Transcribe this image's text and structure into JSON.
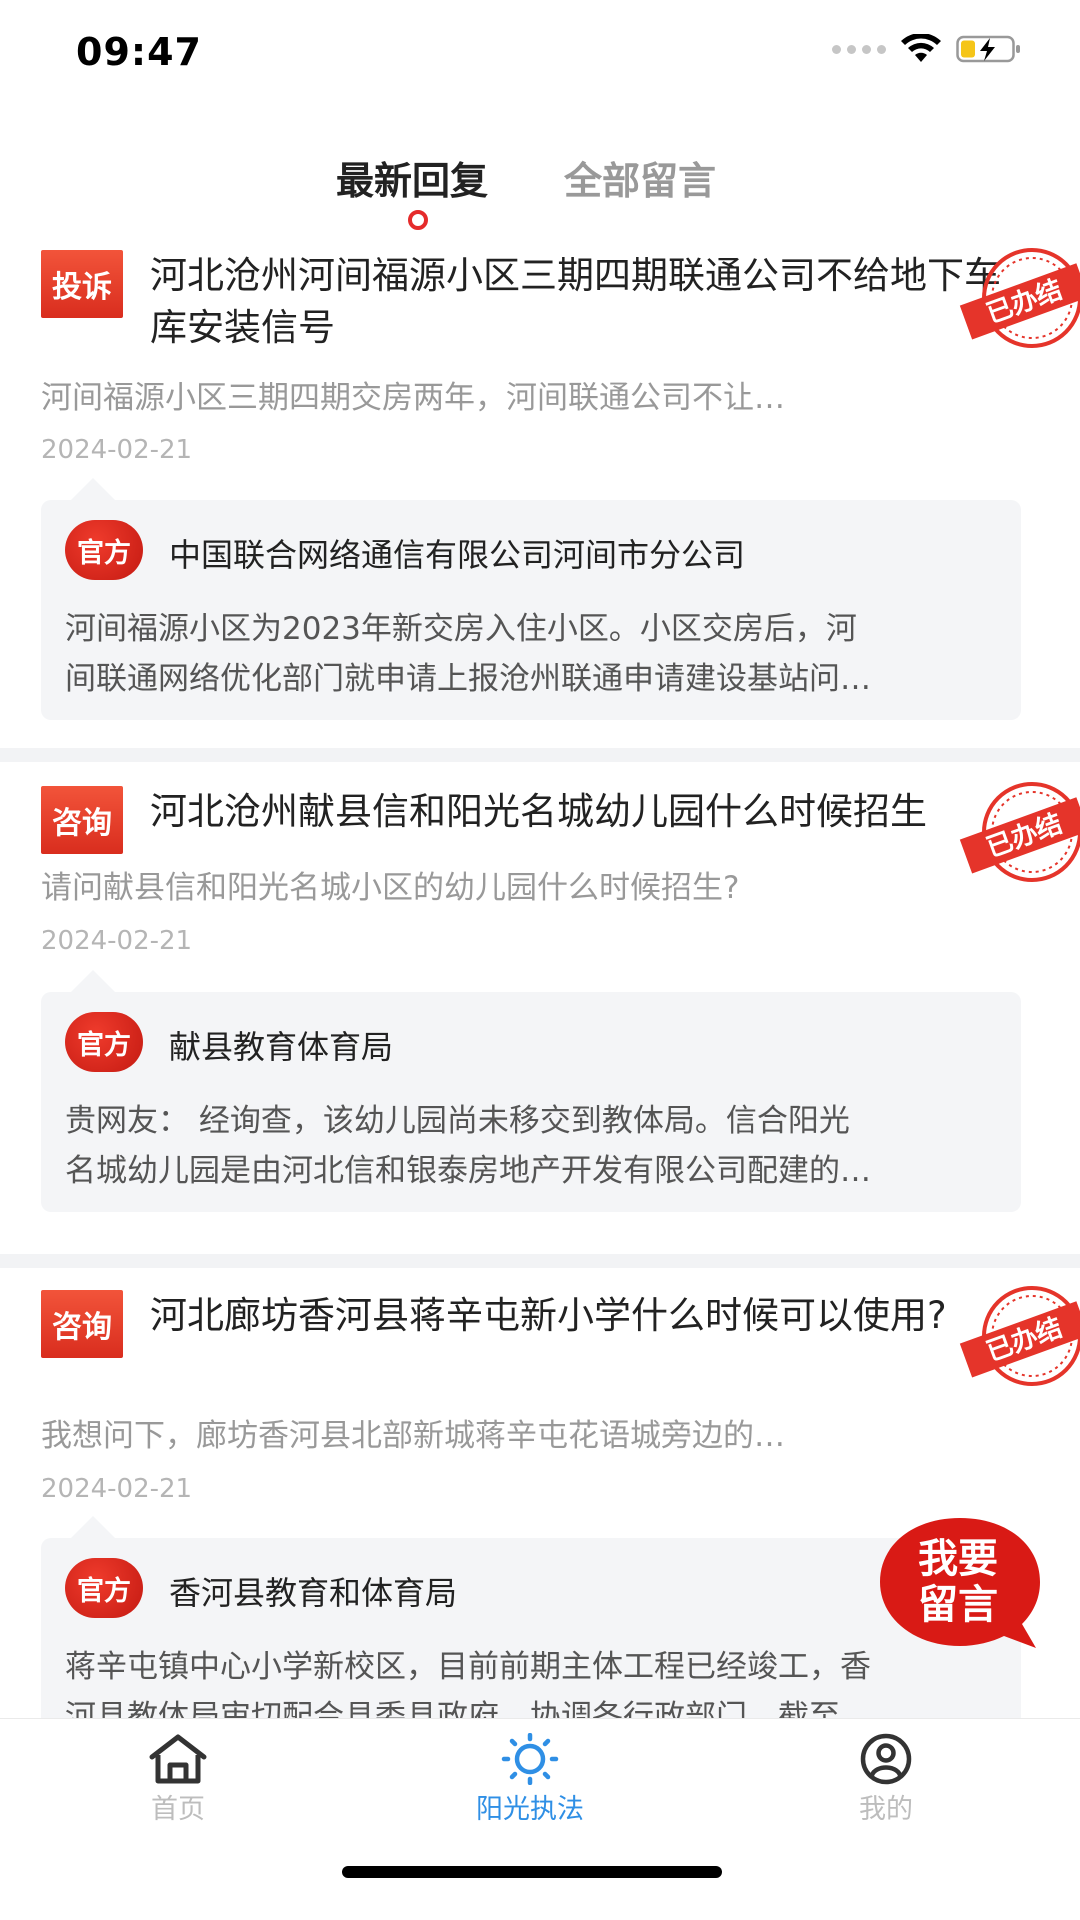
{
  "status": {
    "time": "09:47"
  },
  "tabs": {
    "latest": "最新回复",
    "all": "全部留言"
  },
  "posts": [
    {
      "tag": "投诉",
      "title": "河北沧州河间福源小区三期四期联通公司不给地下车库安装信号",
      "stamp": "已办结",
      "excerpt": "河间福源小区三期四期交房两年，河间联通公司不让…",
      "date": "2024-02-21",
      "badge": "官方",
      "org": "中国联合网络通信有限公司河间市分公司",
      "reply_lines": [
        "河间福源小区为2023年新交房入住小区。小区交房后，河",
        "间联通网络优化部门就申请上报沧州联通申请建设基站问…"
      ]
    },
    {
      "tag": "咨询",
      "title": "河北沧州献县信和阳光名城幼儿园什么时候招生",
      "stamp": "已办结",
      "excerpt": "请问献县信和阳光名城小区的幼儿园什么时候招生?",
      "date": "2024-02-21",
      "badge": "官方",
      "org": "献县教育体育局",
      "reply_lines": [
        "贵网友：  经询查，该幼儿园尚未移交到教体局。信合阳光",
        "名城幼儿园是由河北信和银泰房地产开发有限公司配建的…"
      ]
    },
    {
      "tag": "咨询",
      "title": "河北廊坊香河县蒋辛屯新小学什么时候可以使用?",
      "stamp": "已办结",
      "excerpt": "我想问下，廊坊香河县北部新城蒋辛屯花语城旁边的…",
      "date": "2024-02-21",
      "badge": "官方",
      "org": "香河县教育和体育局",
      "reply_lines": [
        "蒋辛屯镇中心小学新校区，目前前期主体工程已经竣工，香",
        "河县教体局审切配合县委县政府，协调各行政部门，截至…"
      ]
    }
  ],
  "fab": {
    "line1": "我要",
    "line2": "留言"
  },
  "nav": {
    "home": "首页",
    "sun": "阳光执法",
    "me": "我的"
  },
  "colors": {
    "accent": "#e52b2b",
    "active_nav": "#2f8fe5",
    "inactive_nav": "#bdbdbd"
  }
}
